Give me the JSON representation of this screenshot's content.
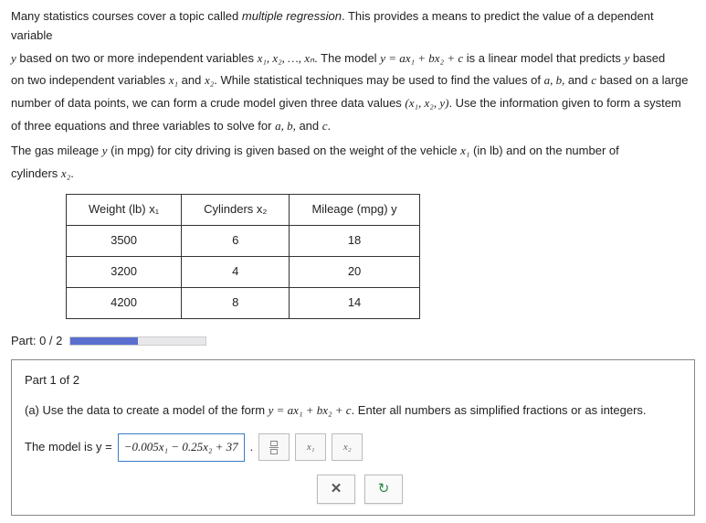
{
  "problem": {
    "p1_a": "Many statistics courses cover a topic called ",
    "p1_b": "multiple regression",
    "p1_c": ". This provides a means to predict the value of a dependent variable ",
    "p2_a": "y",
    "p2_b": " based on two or more independent variables ",
    "p2_c": "x₁, x₂, …, xₙ",
    "p2_d": ". The model ",
    "p2_e": "y = ax₁ + bx₂ + c",
    "p2_f": " is a linear model that predicts ",
    "p2_g": "y",
    "p2_h": " based",
    "p3_a": "on two independent variables ",
    "p3_b": "x₁",
    "p3_c": " and ",
    "p3_d": "x₂",
    "p3_e": ". While statistical techniques may be used to find the values of ",
    "p3_f": "a, b,",
    "p3_g": " and ",
    "p3_h": "c",
    "p3_i": " based on a large",
    "p4_a": "number of data points, we can form a crude model given three data values ",
    "p4_b": "(x₁, x₂, y)",
    "p4_c": ". Use the information given to form a system",
    "p5_a": "of three equations and three variables to solve for ",
    "p5_b": "a, b,",
    "p5_c": " and ",
    "p5_d": "c",
    "p5_e": ".",
    "p6_a": "The gas mileage ",
    "p6_b": "y",
    "p6_c": " (in mpg) for city driving is given based on the weight of the vehicle ",
    "p6_d": "x₁",
    "p6_e": " (in lb) and on the number of",
    "p7_a": "cylinders ",
    "p7_b": "x₂",
    "p7_c": "."
  },
  "chart_data": {
    "type": "table",
    "headers": [
      "Weight (lb) x₁",
      "Cylinders x₂",
      "Mileage (mpg) y"
    ],
    "rows": [
      [
        "3500",
        "6",
        "18"
      ],
      [
        "3200",
        "4",
        "20"
      ],
      [
        "4200",
        "8",
        "14"
      ]
    ]
  },
  "part_progress": "Part: 0 / 2",
  "part1": {
    "title": "Part 1 of 2",
    "question_a": "(a) Use the data to create a model of the form ",
    "question_b": "y = ax₁ + bx₂ + c",
    "question_c": ". Enter all numbers as simplified fractions or as integers.",
    "answer_label": "The model is y = ",
    "answer_value": "−0.005x₁ − 0.25x₂ + 37",
    "period": ".",
    "tool_x1": "x₁",
    "tool_x2": "x₂"
  }
}
